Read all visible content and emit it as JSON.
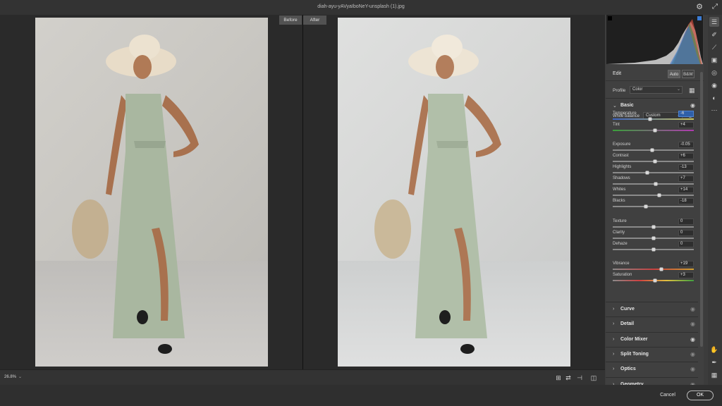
{
  "window": {
    "title": "diah-ayu-yAVyaIboNeY-unsplash (1).jpg",
    "settings_icon": "gear-icon",
    "fullscreen_icon": "expand-icon"
  },
  "canvas": {
    "before_label": "Before",
    "after_label": "After"
  },
  "bottom_bar": {
    "zoom": "26.8%",
    "tools": [
      "before-after-swap-icon",
      "copy-settings-icon",
      "copy-to-before-icon",
      "compare-view-icon"
    ]
  },
  "footer": {
    "cancel_label": "Cancel",
    "ok_label": "OK"
  },
  "panel": {
    "edit_label": "Edit",
    "auto_label": "Auto",
    "bw_label": "B&W",
    "profile_label": "Profile",
    "profile_value": "Color",
    "basic": {
      "title": "Basic",
      "white_balance_label": "White balance",
      "white_balance_value": "Custom",
      "sliders": [
        {
          "label": "Temperature",
          "value": "-6",
          "position": 0.46,
          "track": "temperature",
          "active": true
        },
        {
          "label": "Tint",
          "value": "+4",
          "position": 0.52,
          "track": "tint",
          "active": false
        },
        {
          "label": "Exposure",
          "value": "-0.05",
          "position": 0.49,
          "track": "gray",
          "active": false
        },
        {
          "label": "Contrast",
          "value": "+6",
          "position": 0.52,
          "track": "gray",
          "active": false
        },
        {
          "label": "Highlights",
          "value": "-13",
          "position": 0.43,
          "track": "gray",
          "active": false
        },
        {
          "label": "Shadows",
          "value": "+7",
          "position": 0.53,
          "track": "gray",
          "active": false
        },
        {
          "label": "Whites",
          "value": "+14",
          "position": 0.57,
          "track": "gray",
          "active": false
        },
        {
          "label": "Blacks",
          "value": "-18",
          "position": 0.41,
          "track": "gray",
          "active": false
        },
        {
          "label": "Texture",
          "value": "0",
          "position": 0.5,
          "track": "gray",
          "active": false
        },
        {
          "label": "Clarity",
          "value": "0",
          "position": 0.5,
          "track": "gray",
          "active": false
        },
        {
          "label": "Dehaze",
          "value": "0",
          "position": 0.5,
          "track": "gray",
          "active": false
        },
        {
          "label": "Vibrance",
          "value": "+19",
          "position": 0.6,
          "track": "vibrance",
          "active": false
        },
        {
          "label": "Saturation",
          "value": "+3",
          "position": 0.52,
          "track": "saturation",
          "active": false
        }
      ]
    },
    "sections": [
      "Curve",
      "Detail",
      "Color Mixer",
      "Split Toning",
      "Optics",
      "Geometry"
    ]
  },
  "tool_rail": {
    "top": [
      "edit-sliders-icon",
      "healing-brush-icon",
      "adjustment-brush-icon",
      "graduated-filter-icon",
      "radial-filter-icon",
      "red-eye-icon",
      "presets-icon",
      "more-icon"
    ],
    "bottom": [
      "hand-icon",
      "color-sampler-icon",
      "grid-icon"
    ]
  },
  "colors": {
    "accent": "#2f5fa8",
    "panel_bg": "#404040",
    "canvas_bg": "#2a2a2a"
  }
}
